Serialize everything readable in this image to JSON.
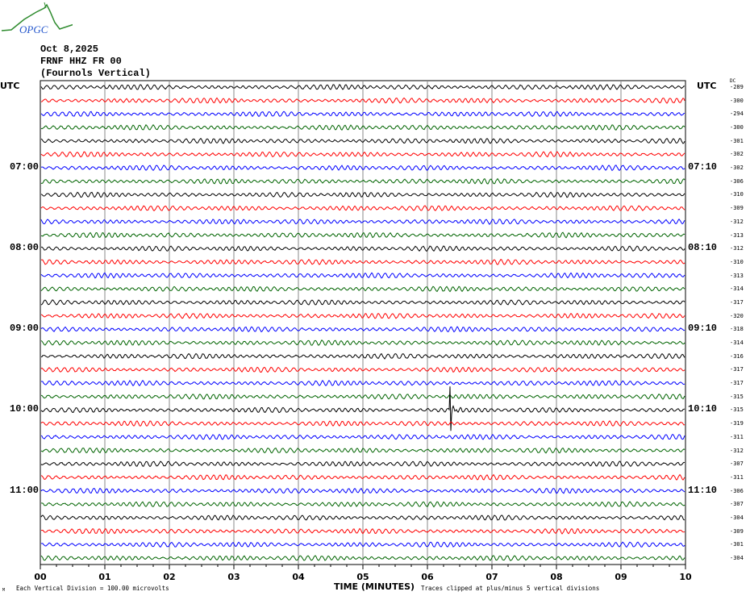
{
  "logo_text": "OPGC",
  "header": {
    "date": "Oct 8,2025",
    "station": "FRNF HHZ FR 00",
    "description": "(Fournols Vertical)"
  },
  "utc_left": "UTC",
  "utc_right": "UTC",
  "dc_label": "DC",
  "chart_data": {
    "type": "line",
    "subtype": "helicorder",
    "xlabel": "TIME (MINUTES)",
    "x_ticks": [
      "00",
      "01",
      "02",
      "03",
      "04",
      "05",
      "06",
      "07",
      "08",
      "09",
      "10"
    ],
    "xlim": [
      0,
      10
    ],
    "minutes_per_line": 10,
    "grid": true,
    "trace_colors": [
      "#000000",
      "#ff0000",
      "#0000ff",
      "#006400"
    ],
    "left_time_labels": [
      {
        "row": 6,
        "label": "07:00"
      },
      {
        "row": 12,
        "label": "08:00"
      },
      {
        "row": 18,
        "label": "09:00"
      },
      {
        "row": 24,
        "label": "10:00"
      },
      {
        "row": 30,
        "label": "11:00"
      }
    ],
    "right_time_labels": [
      {
        "row": 6,
        "label": "07:10"
      },
      {
        "row": 12,
        "label": "08:10"
      },
      {
        "row": 18,
        "label": "09:10"
      },
      {
        "row": 24,
        "label": "10:10"
      },
      {
        "row": 30,
        "label": "11:10"
      }
    ],
    "dc_offsets": [
      -289,
      -300,
      -294,
      -300,
      -301,
      -302,
      -302,
      -306,
      -310,
      -309,
      -312,
      -313,
      -312,
      -310,
      -313,
      -314,
      -317,
      -320,
      -318,
      -314,
      -316,
      -317,
      -317,
      -315,
      -315,
      -319,
      -311,
      -312,
      -307,
      -311,
      -306,
      -307,
      -304,
      -309,
      -301,
      -304
    ],
    "events": [
      {
        "row": 24,
        "minute": 6.35
      }
    ]
  },
  "footer": {
    "scale": "Each Vertical Division =  100.00 microvolts",
    "clip_note": "Traces clipped at plus/minus 5 vertical divisions",
    "corner_mark": "M"
  }
}
